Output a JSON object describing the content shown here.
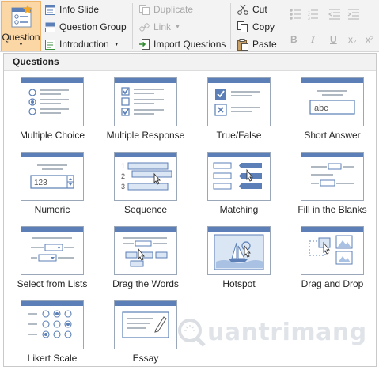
{
  "ribbon": {
    "question_button": "Question",
    "group1": {
      "info_slide": "Info Slide",
      "question_group": "Question Group",
      "introduction": "Introduction"
    },
    "group2": {
      "duplicate": "Duplicate",
      "link": "Link",
      "import_questions": "Import Questions"
    },
    "group3": {
      "cut": "Cut",
      "copy": "Copy",
      "paste": "Paste"
    },
    "format": {
      "bold": "B",
      "italic": "I",
      "underline": "U",
      "subscript": "x₂",
      "superscript": "x²"
    }
  },
  "gallery": {
    "header": "Questions",
    "items": [
      {
        "label": "Multiple Choice",
        "icon": "multiple-choice-icon"
      },
      {
        "label": "Multiple Response",
        "icon": "multiple-response-icon"
      },
      {
        "label": "True/False",
        "icon": "true-false-icon"
      },
      {
        "label": "Short Answer",
        "icon": "short-answer-icon"
      },
      {
        "label": "Numeric",
        "icon": "numeric-icon"
      },
      {
        "label": "Sequence",
        "icon": "sequence-icon"
      },
      {
        "label": "Matching",
        "icon": "matching-icon"
      },
      {
        "label": "Fill in the Blanks",
        "icon": "fill-blanks-icon"
      },
      {
        "label": "Select from Lists",
        "icon": "select-lists-icon"
      },
      {
        "label": "Drag the Words",
        "icon": "drag-words-icon"
      },
      {
        "label": "Hotspot",
        "icon": "hotspot-icon"
      },
      {
        "label": "Drag and Drop",
        "icon": "drag-drop-icon"
      },
      {
        "label": "Likert Scale",
        "icon": "likert-scale-icon"
      },
      {
        "label": "Essay",
        "icon": "essay-icon"
      }
    ],
    "short_answer_text": "abc",
    "numeric_value": "123",
    "sequence_numbers": [
      "1",
      "2",
      "3"
    ]
  },
  "watermark": "uantrimang",
  "colors": {
    "accent_blue": "#5b7fb6",
    "selected_button": "#fbd7a6",
    "card_border": "#9aa7b8"
  }
}
